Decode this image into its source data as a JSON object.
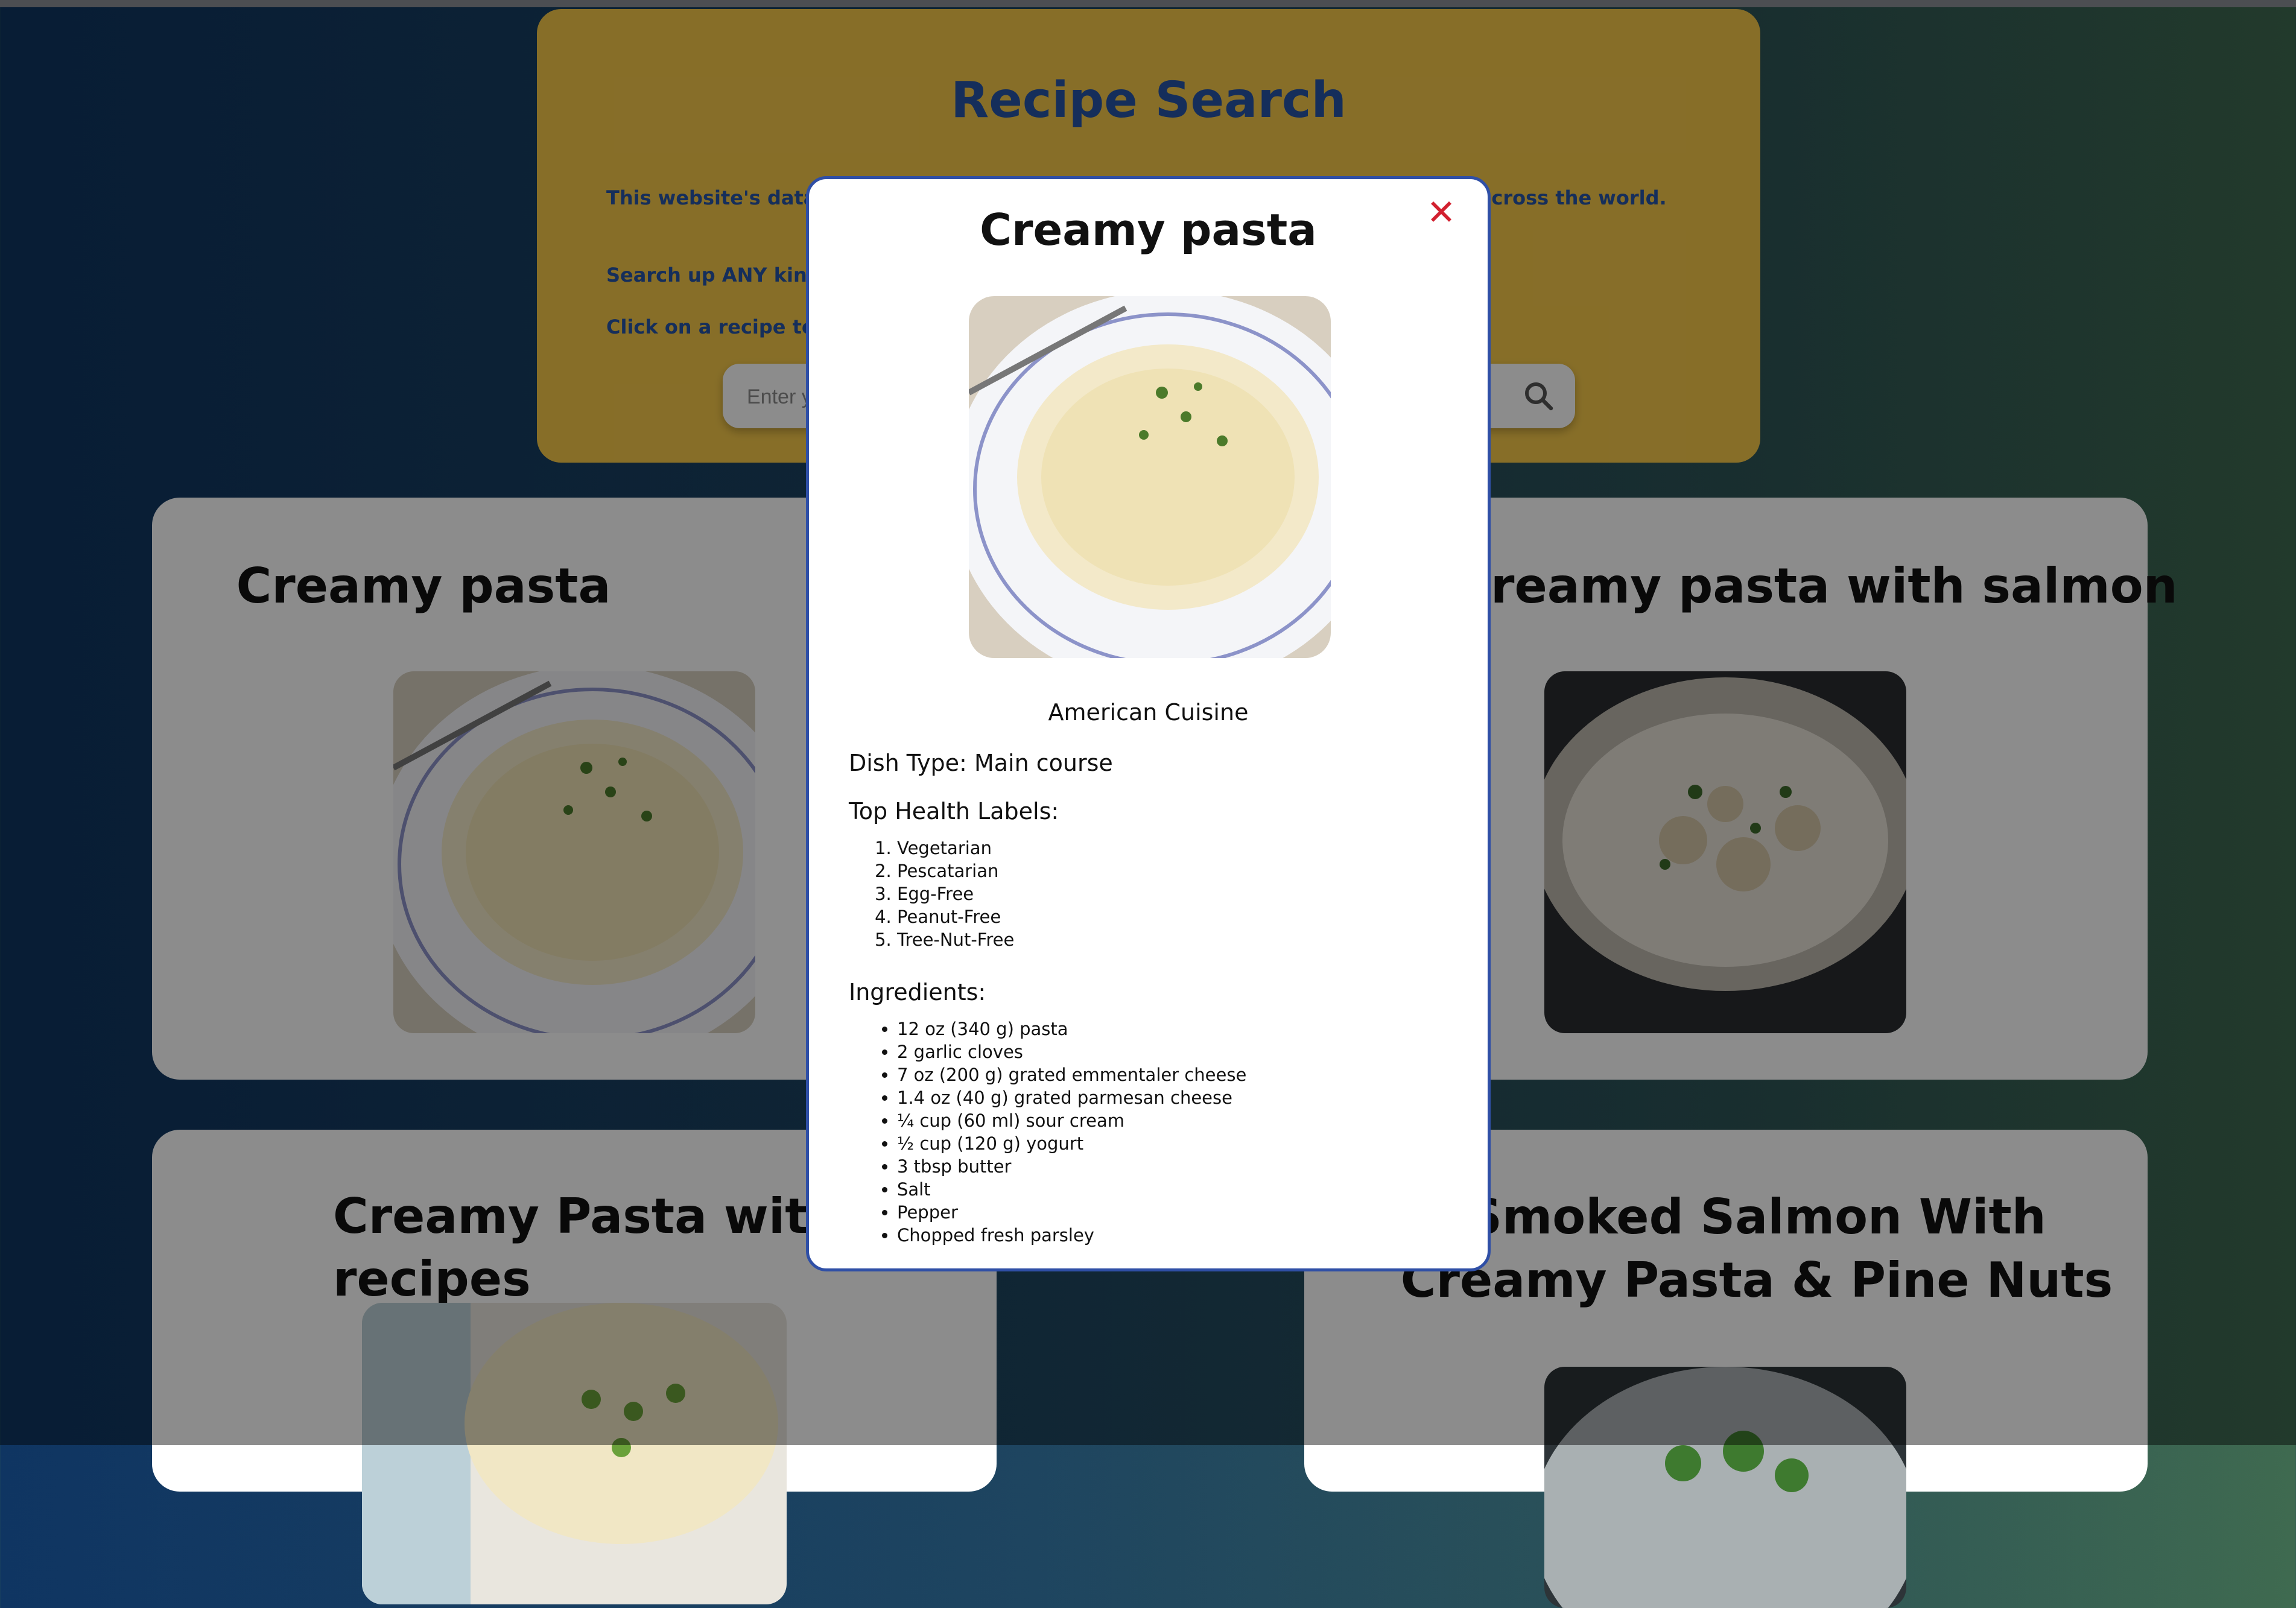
{
  "header": {
    "title": "Recipe Search",
    "line1": "This website's data is sourced from Edamam, an API with over 2 million recipes across the world.",
    "line2": "Search up ANY kind of food to find recipes.",
    "line3": "Click on a recipe to learn more about it!",
    "search_placeholder": "Enter your search"
  },
  "cards": [
    {
      "title": "Creamy pasta",
      "image": "creamy-pasta-photo"
    },
    {
      "title": "Creamy pasta with salmon",
      "image": "salmon-pasta-photo"
    },
    {
      "title": "Creamy Pasta with Peas recipes",
      "image": "peas-pasta-photo"
    },
    {
      "title": "Smoked Salmon With Creamy Pasta & Pine Nuts",
      "image": "salmon-pine-nut-photo"
    }
  ],
  "modal": {
    "title": "Creamy pasta",
    "close": "✕",
    "cuisine": "American Cuisine",
    "dish_type": "Dish Type: Main course",
    "health_heading": "Top Health Labels:",
    "health_labels": [
      "Vegetarian",
      "Pescatarian",
      "Egg-Free",
      "Peanut-Free",
      "Tree-Nut-Free"
    ],
    "ingredients_heading": "Ingredients:",
    "ingredients": [
      "12 oz (340 g) pasta",
      "2 garlic cloves",
      "7 oz (200 g) grated emmentaler cheese",
      "1.4 oz (40 g) grated parmesan cheese",
      "¼ cup (60 ml) sour cream",
      "½ cup (120 g) yogurt",
      "3 tbsp butter",
      "Salt",
      "Pepper",
      "Chopped fresh parsley"
    ]
  },
  "colors": {
    "accent": "#2754a6",
    "header_bg": "#f6c94a",
    "close": "#d2202f"
  }
}
